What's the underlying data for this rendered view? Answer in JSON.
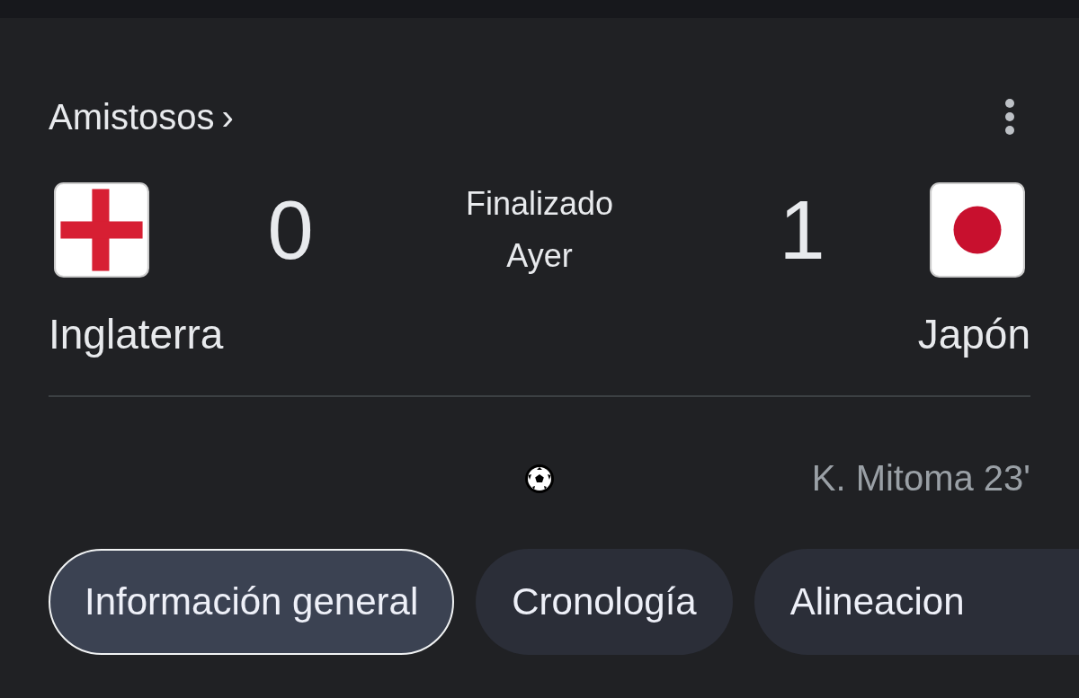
{
  "competition": {
    "label": "Amistosos",
    "chevron": "›"
  },
  "match": {
    "status": "Finalizado",
    "date": "Ayer",
    "home": {
      "name": "Inglaterra",
      "score": "0"
    },
    "away": {
      "name": "Japón",
      "score": "1",
      "goals": [
        "K. Mitoma 23'"
      ]
    }
  },
  "tabs": [
    {
      "label": "Información general",
      "selected": true
    },
    {
      "label": "Cronología",
      "selected": false
    },
    {
      "label": "Alineacion",
      "selected": false
    }
  ]
}
